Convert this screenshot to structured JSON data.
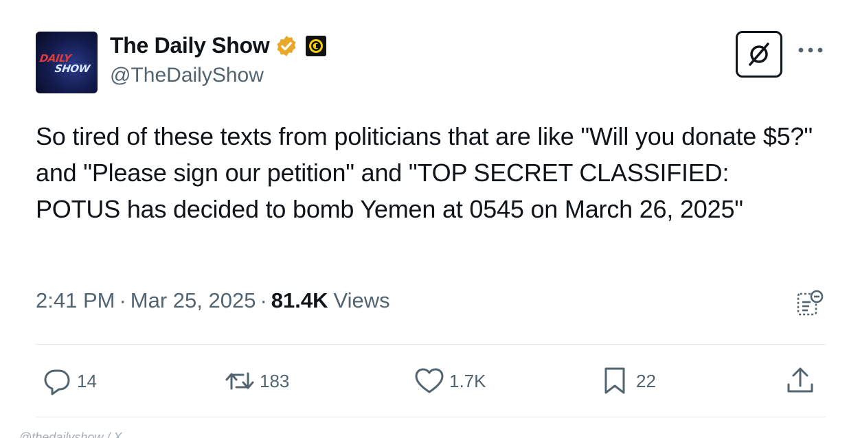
{
  "account": {
    "display_name": "The Daily Show",
    "handle": "@TheDailyShow",
    "avatar_text_line1": "DAILY",
    "avatar_text_line2": "SHOW",
    "verified_color": "#e8a92a"
  },
  "tweet": {
    "text": "So tired of these texts from politicians that are like \"Will you donate $5?\" and \"Please sign our petition\" and \"TOP SECRET CLASSIFIED: POTUS has decided to bomb Yemen at 0545 on March 26, 2025\"",
    "time": "2:41 PM",
    "date": "Mar 25, 2025",
    "views_count": "81.4K",
    "views_label": "Views"
  },
  "actions": {
    "replies": "14",
    "reposts": "183",
    "likes": "1.7K",
    "bookmarks": "22"
  },
  "icons": {
    "verified": "verified-badge-icon",
    "affiliate": "comedy-central-icon",
    "grok": "grok-icon",
    "more": "more-icon",
    "analytics": "analytics-icon",
    "reply": "reply-icon",
    "repost": "repost-icon",
    "like": "heart-icon",
    "bookmark": "bookmark-icon",
    "share": "share-icon"
  },
  "footer": {
    "caption": "@thedailyshow / X"
  }
}
